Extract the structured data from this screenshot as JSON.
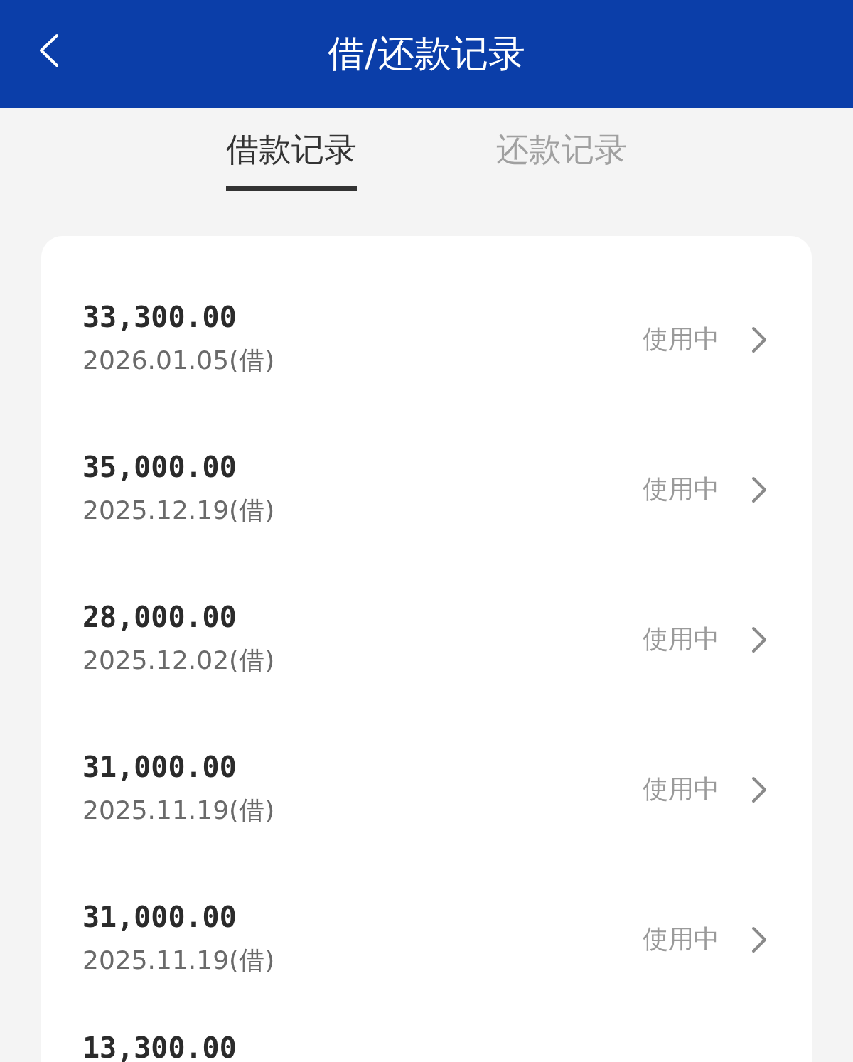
{
  "header": {
    "title": "借/还款记录"
  },
  "tabs": [
    {
      "label": "借款记录",
      "selected": true
    },
    {
      "label": "还款记录",
      "selected": false
    }
  ],
  "records": [
    {
      "amount": "33,300.00",
      "date": "2026.01.05(借)",
      "status": "使用中"
    },
    {
      "amount": "35,000.00",
      "date": "2025.12.19(借)",
      "status": "使用中"
    },
    {
      "amount": "28,000.00",
      "date": "2025.12.02(借)",
      "status": "使用中"
    },
    {
      "amount": "31,000.00",
      "date": "2025.11.19(借)",
      "status": "使用中"
    },
    {
      "amount": "31,000.00",
      "date": "2025.11.19(借)",
      "status": "使用中"
    },
    {
      "amount": "13,300.00"
    }
  ]
}
